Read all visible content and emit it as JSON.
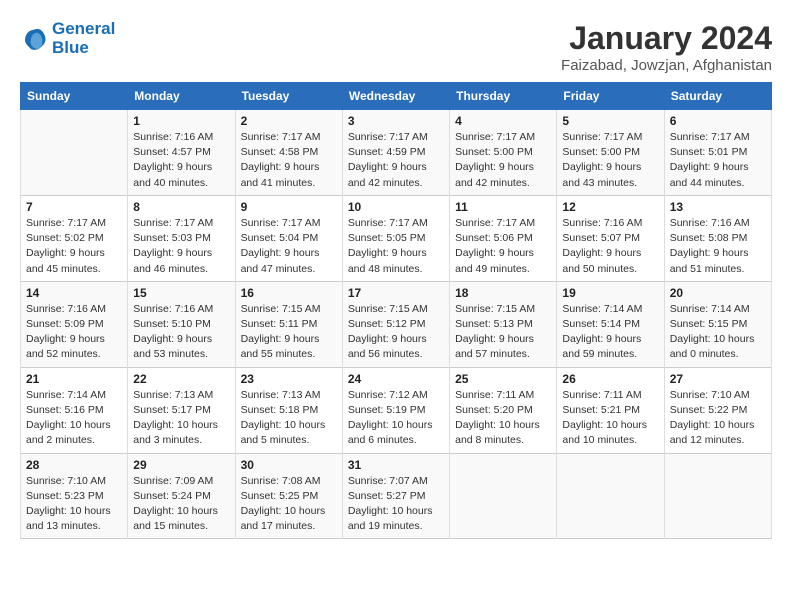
{
  "header": {
    "logo_line1": "General",
    "logo_line2": "Blue",
    "month_year": "January 2024",
    "location": "Faizabad, Jowzjan, Afghanistan"
  },
  "days_of_week": [
    "Sunday",
    "Monday",
    "Tuesday",
    "Wednesday",
    "Thursday",
    "Friday",
    "Saturday"
  ],
  "weeks": [
    [
      {
        "day": "",
        "info": ""
      },
      {
        "day": "1",
        "info": "Sunrise: 7:16 AM\nSunset: 4:57 PM\nDaylight: 9 hours\nand 40 minutes."
      },
      {
        "day": "2",
        "info": "Sunrise: 7:17 AM\nSunset: 4:58 PM\nDaylight: 9 hours\nand 41 minutes."
      },
      {
        "day": "3",
        "info": "Sunrise: 7:17 AM\nSunset: 4:59 PM\nDaylight: 9 hours\nand 42 minutes."
      },
      {
        "day": "4",
        "info": "Sunrise: 7:17 AM\nSunset: 5:00 PM\nDaylight: 9 hours\nand 42 minutes."
      },
      {
        "day": "5",
        "info": "Sunrise: 7:17 AM\nSunset: 5:00 PM\nDaylight: 9 hours\nand 43 minutes."
      },
      {
        "day": "6",
        "info": "Sunrise: 7:17 AM\nSunset: 5:01 PM\nDaylight: 9 hours\nand 44 minutes."
      }
    ],
    [
      {
        "day": "7",
        "info": "Sunrise: 7:17 AM\nSunset: 5:02 PM\nDaylight: 9 hours\nand 45 minutes."
      },
      {
        "day": "8",
        "info": "Sunrise: 7:17 AM\nSunset: 5:03 PM\nDaylight: 9 hours\nand 46 minutes."
      },
      {
        "day": "9",
        "info": "Sunrise: 7:17 AM\nSunset: 5:04 PM\nDaylight: 9 hours\nand 47 minutes."
      },
      {
        "day": "10",
        "info": "Sunrise: 7:17 AM\nSunset: 5:05 PM\nDaylight: 9 hours\nand 48 minutes."
      },
      {
        "day": "11",
        "info": "Sunrise: 7:17 AM\nSunset: 5:06 PM\nDaylight: 9 hours\nand 49 minutes."
      },
      {
        "day": "12",
        "info": "Sunrise: 7:16 AM\nSunset: 5:07 PM\nDaylight: 9 hours\nand 50 minutes."
      },
      {
        "day": "13",
        "info": "Sunrise: 7:16 AM\nSunset: 5:08 PM\nDaylight: 9 hours\nand 51 minutes."
      }
    ],
    [
      {
        "day": "14",
        "info": "Sunrise: 7:16 AM\nSunset: 5:09 PM\nDaylight: 9 hours\nand 52 minutes."
      },
      {
        "day": "15",
        "info": "Sunrise: 7:16 AM\nSunset: 5:10 PM\nDaylight: 9 hours\nand 53 minutes."
      },
      {
        "day": "16",
        "info": "Sunrise: 7:15 AM\nSunset: 5:11 PM\nDaylight: 9 hours\nand 55 minutes."
      },
      {
        "day": "17",
        "info": "Sunrise: 7:15 AM\nSunset: 5:12 PM\nDaylight: 9 hours\nand 56 minutes."
      },
      {
        "day": "18",
        "info": "Sunrise: 7:15 AM\nSunset: 5:13 PM\nDaylight: 9 hours\nand 57 minutes."
      },
      {
        "day": "19",
        "info": "Sunrise: 7:14 AM\nSunset: 5:14 PM\nDaylight: 9 hours\nand 59 minutes."
      },
      {
        "day": "20",
        "info": "Sunrise: 7:14 AM\nSunset: 5:15 PM\nDaylight: 10 hours\nand 0 minutes."
      }
    ],
    [
      {
        "day": "21",
        "info": "Sunrise: 7:14 AM\nSunset: 5:16 PM\nDaylight: 10 hours\nand 2 minutes."
      },
      {
        "day": "22",
        "info": "Sunrise: 7:13 AM\nSunset: 5:17 PM\nDaylight: 10 hours\nand 3 minutes."
      },
      {
        "day": "23",
        "info": "Sunrise: 7:13 AM\nSunset: 5:18 PM\nDaylight: 10 hours\nand 5 minutes."
      },
      {
        "day": "24",
        "info": "Sunrise: 7:12 AM\nSunset: 5:19 PM\nDaylight: 10 hours\nand 6 minutes."
      },
      {
        "day": "25",
        "info": "Sunrise: 7:11 AM\nSunset: 5:20 PM\nDaylight: 10 hours\nand 8 minutes."
      },
      {
        "day": "26",
        "info": "Sunrise: 7:11 AM\nSunset: 5:21 PM\nDaylight: 10 hours\nand 10 minutes."
      },
      {
        "day": "27",
        "info": "Sunrise: 7:10 AM\nSunset: 5:22 PM\nDaylight: 10 hours\nand 12 minutes."
      }
    ],
    [
      {
        "day": "28",
        "info": "Sunrise: 7:10 AM\nSunset: 5:23 PM\nDaylight: 10 hours\nand 13 minutes."
      },
      {
        "day": "29",
        "info": "Sunrise: 7:09 AM\nSunset: 5:24 PM\nDaylight: 10 hours\nand 15 minutes."
      },
      {
        "day": "30",
        "info": "Sunrise: 7:08 AM\nSunset: 5:25 PM\nDaylight: 10 hours\nand 17 minutes."
      },
      {
        "day": "31",
        "info": "Sunrise: 7:07 AM\nSunset: 5:27 PM\nDaylight: 10 hours\nand 19 minutes."
      },
      {
        "day": "",
        "info": ""
      },
      {
        "day": "",
        "info": ""
      },
      {
        "day": "",
        "info": ""
      }
    ]
  ]
}
